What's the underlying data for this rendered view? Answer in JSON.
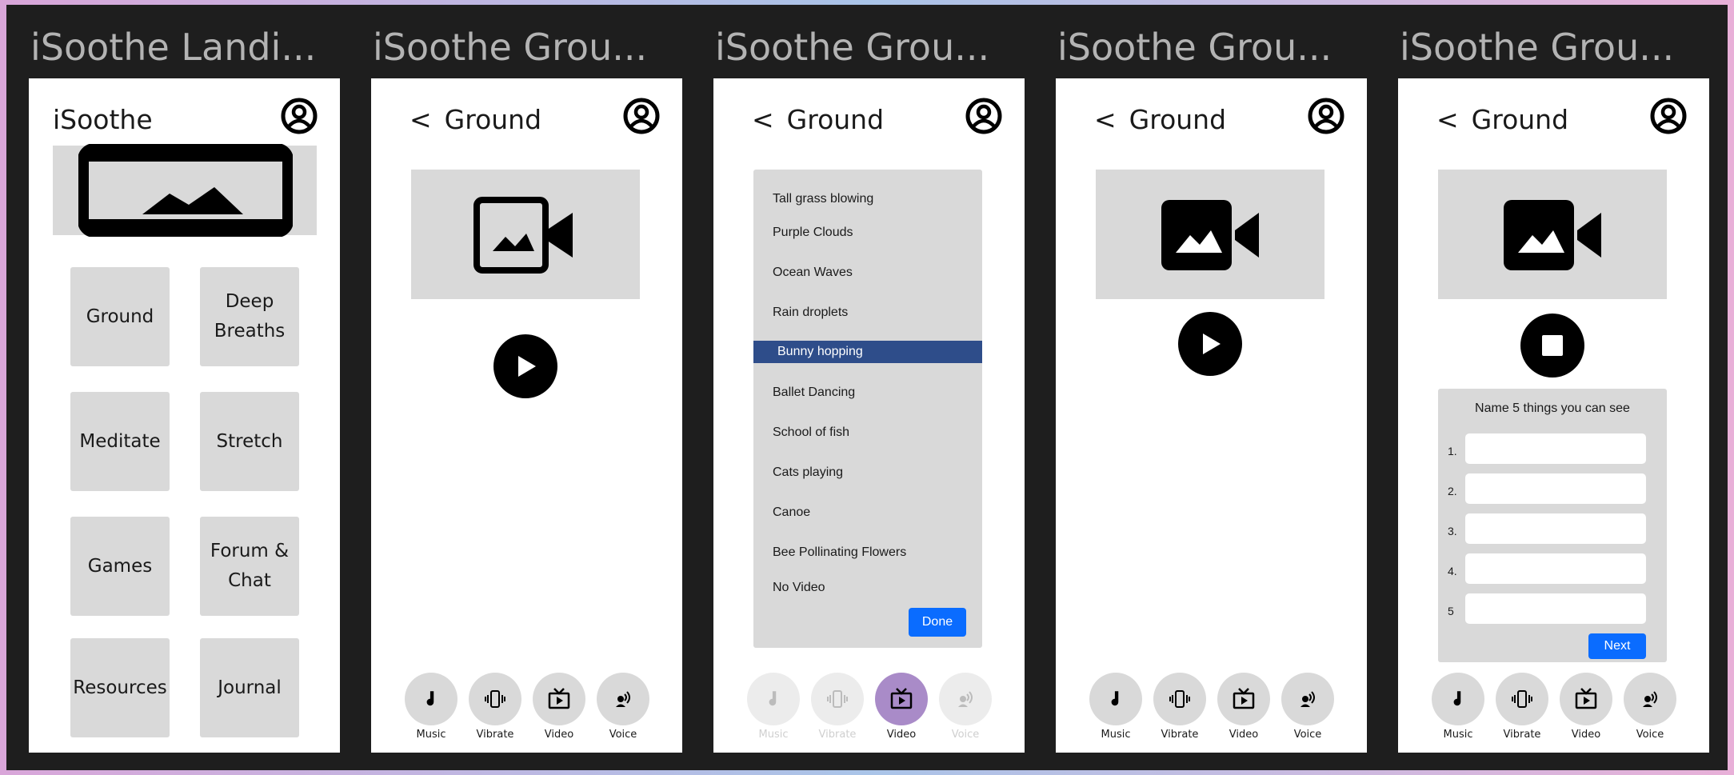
{
  "frames": [
    {
      "title": "iSoothe Landi..."
    },
    {
      "title": "iSoothe Grou..."
    },
    {
      "title": "iSoothe Grou..."
    },
    {
      "title": "iSoothe Grou..."
    },
    {
      "title": "iSoothe Grou..."
    }
  ],
  "landing": {
    "app_name": "iSoothe",
    "tiles": [
      "Ground",
      "Deep Breaths",
      "Meditate",
      "Stretch",
      "Games",
      "Forum & Chat",
      "Resources",
      "Journal"
    ]
  },
  "ground": {
    "back_symbol": "<",
    "title": "Ground"
  },
  "toolbar": {
    "music": "Music",
    "vibrate": "Vibrate",
    "video": "Video",
    "voice": "Voice"
  },
  "video_list": {
    "items": [
      "Tall grass blowing",
      "Purple Clouds",
      "Ocean Waves",
      "Rain droplets",
      "Bunny hopping",
      "Ballet Dancing",
      "School of fish",
      "Cats playing",
      "Canoe",
      "Bee Pollinating Flowers",
      "No Video"
    ],
    "selected": "Bunny hopping",
    "done_label": "Done"
  },
  "quiz": {
    "prompt": "Name 5 things you can see",
    "numbers": [
      "1.",
      "2.",
      "3.",
      "4.",
      "5"
    ],
    "next_label": "Next"
  },
  "colors": {
    "selected_row": "#2e4d8a",
    "button_blue": "#0a6cff",
    "active_toolbar": "#a98bc8"
  }
}
